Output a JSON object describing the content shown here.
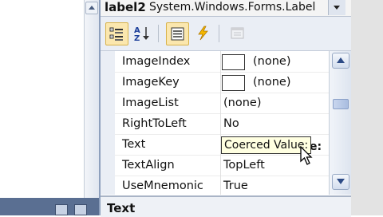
{
  "object_selector": {
    "name": "label2",
    "type": "System.Windows.Forms.Label"
  },
  "toolbar": {
    "categorized_icon": "categorized-icon",
    "alphabetical_icon": "alphabetical-icon",
    "properties_icon": "properties-icon",
    "events_icon": "lightning-icon",
    "pages_icon": "property-pages-icon"
  },
  "properties": [
    {
      "name": "ImageIndex",
      "value": "(none)",
      "swatch": true
    },
    {
      "name": "ImageKey",
      "value": "(none)",
      "swatch": true
    },
    {
      "name": "ImageList",
      "value": "(none)",
      "swatch": false
    },
    {
      "name": "RightToLeft",
      "value": "No",
      "swatch": false
    },
    {
      "name": "Text",
      "value": "",
      "swatch": false
    },
    {
      "name": "TextAlign",
      "value": "TopLeft",
      "swatch": false
    },
    {
      "name": "UseMnemonic",
      "value": "True",
      "swatch": false
    }
  ],
  "tooltip": {
    "text": "Coerced Value:",
    "tail": "e:"
  },
  "description": {
    "title": "Text"
  },
  "colors": {
    "selected_button": "#fbe7ae",
    "toolbar_bg": "#eaeef5",
    "tooltip_bg": "#ffffe1",
    "scroll_arrow": "#2d4b86"
  }
}
